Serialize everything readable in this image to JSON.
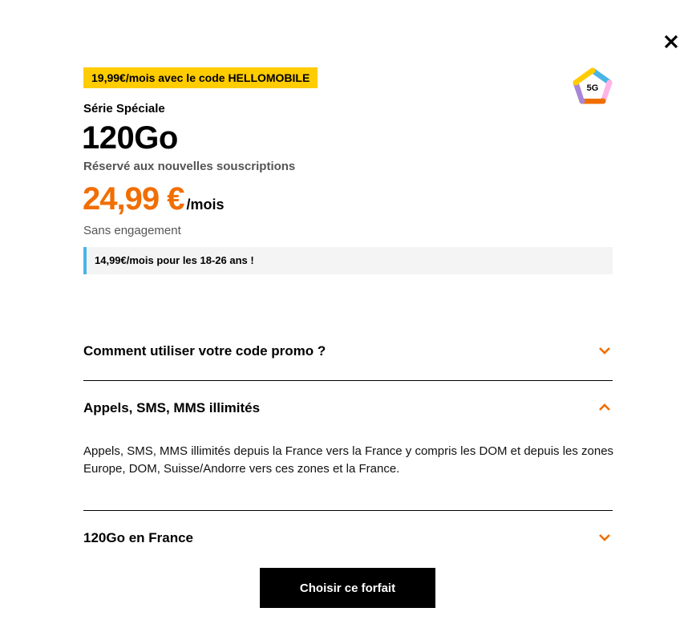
{
  "modal": {
    "close_icon": "close-icon"
  },
  "offer": {
    "promo_badge": "19,99€/mois avec le code HELLOMOBILE",
    "network_badge": "5G",
    "series_label": "Série Spéciale",
    "plan_name": "120Go",
    "subtitle": "Réservé aux nouvelles souscriptions",
    "price": "24,99 €",
    "price_unit": "/mois",
    "commitment": "Sans engagement",
    "youth_offer": "14,99€/mois pour les 18-26 ans !"
  },
  "accordion": {
    "items": [
      {
        "title": "Comment utiliser votre code promo ?",
        "expanded": false
      },
      {
        "title": "Appels, SMS, MMS illimités",
        "expanded": true,
        "body": "Appels, SMS, MMS illimités depuis la France vers la France y compris les DOM et depuis les zones Europe, DOM, Suisse/Andorre vers ces zones et la France."
      },
      {
        "title": "120Go en France",
        "expanded": false
      }
    ]
  },
  "cta": {
    "label": "Choisir ce forfait"
  },
  "colors": {
    "accent": "#f16e00",
    "promo_badge_bg": "#ffcc00",
    "info_bar": "#4bb4e6"
  }
}
